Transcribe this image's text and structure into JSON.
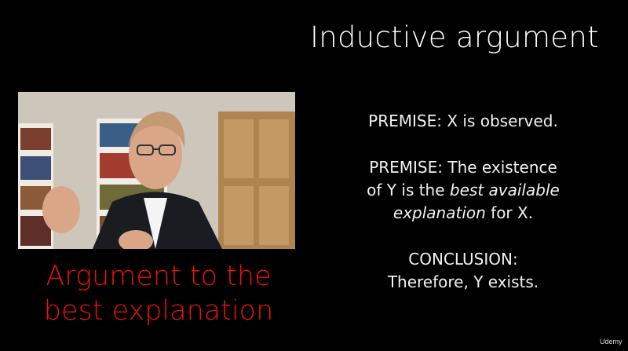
{
  "title": "Inductive argument",
  "caption": {
    "line1": "Argument to the",
    "line2": "best explanation"
  },
  "premise1": "PREMISE: X is observed.",
  "premise2": {
    "line1": "PREMISE: The existence",
    "line2_prefix": "of Y is the ",
    "line2_italic": "best available",
    "line3_italic": "explanation",
    "line3_suffix": " for X."
  },
  "conclusion": {
    "line1": "CONCLUSION:",
    "line2": "Therefore, Y exists."
  },
  "logo": "Udemy",
  "colors": {
    "background": "#000000",
    "caption": "#e8120c",
    "text": "#ffffff"
  }
}
